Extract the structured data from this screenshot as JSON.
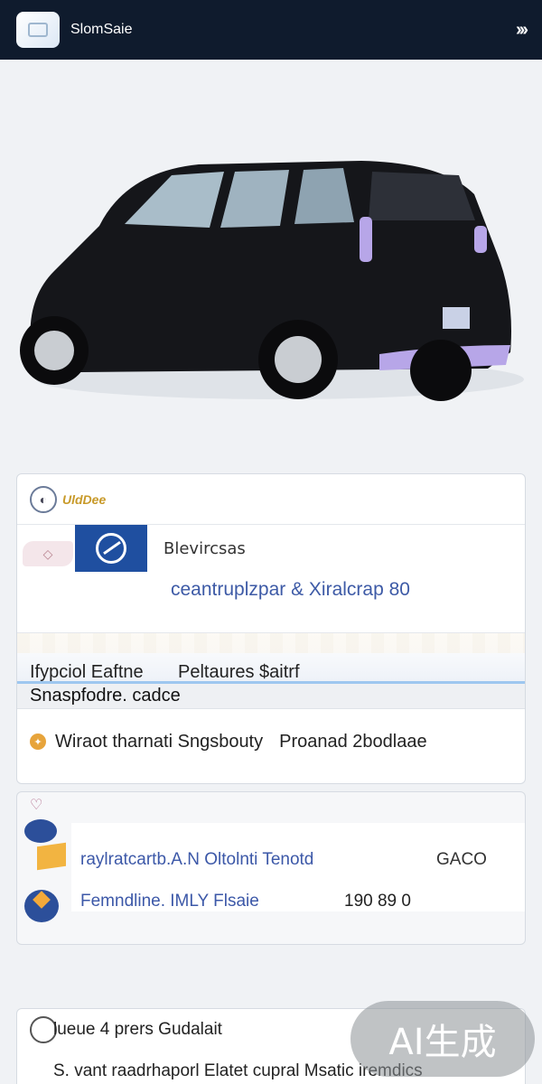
{
  "header": {
    "logo_icon": "app-logo-icon",
    "title": "SlomSaie",
    "menu_icon": "chevrons-right-icon"
  },
  "hero": {
    "image": "black-hatchback-car-photo",
    "colors": {
      "body": "#15161a",
      "accent": "#b7a6e8"
    }
  },
  "listing": {
    "brand_text": "UldDee",
    "dealer_name": "Blevircsas",
    "dealer_subtitle": "ceantruplzpar & Xiralcrap 80",
    "banner_left": "Ifypciol Eaftne",
    "banner_right": "Peltaures $aitrf",
    "spec_text": "Snaspfodre. cadce",
    "cta_left": "Wiraot tharnati Sngsbouty",
    "cta_right": "Proanad 2bodlaae"
  },
  "details": {
    "line1_left": "raylratcartb.A.N Oltolnti Tenotd",
    "line1_right": "GACO",
    "line2_left": "Femndline. IMLY Flsaie",
    "line2_right": "190 89 0"
  },
  "bottom": {
    "line1": "lueue 4 prers Gudalait",
    "line2": "S. vant raadrhaporl Elatet cupral Msatic iremdics"
  },
  "watermark": "AI生成"
}
